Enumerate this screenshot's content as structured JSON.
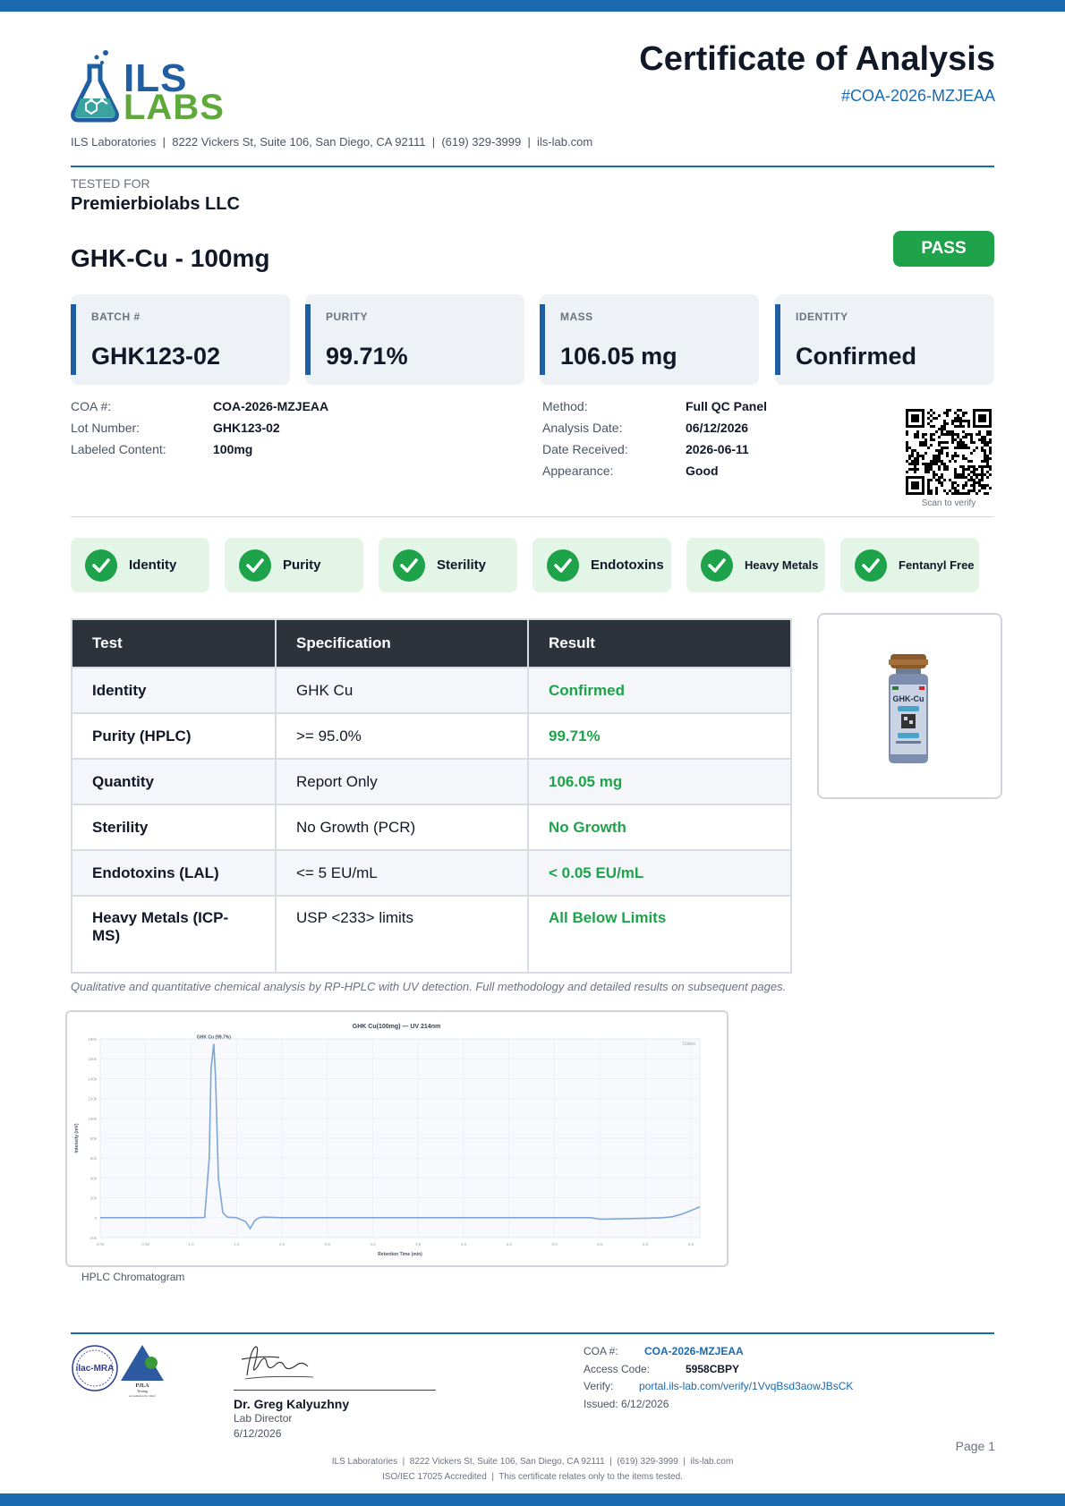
{
  "header": {
    "logo_text_top": "ILS",
    "logo_text_bottom": "LABS",
    "address_line": "ILS Laboratories  |  8222 Vickers St, Suite 106, San Diego, CA 92111  |  (619) 329-3999  |  ils-lab.com",
    "title": "Certificate of Analysis",
    "coa_ref": "#COA-2026-MZJEAA"
  },
  "client": {
    "label": "TESTED FOR",
    "name": "Premierbiolabs LLC"
  },
  "product": {
    "name": "GHK-Cu - 100mg",
    "status": "PASS"
  },
  "stats": [
    {
      "label": "BATCH #",
      "value": "GHK123-02"
    },
    {
      "label": "PURITY",
      "value": "99.71%"
    },
    {
      "label": "MASS",
      "value": "106.05 mg"
    },
    {
      "label": "IDENTITY",
      "value": "Confirmed"
    }
  ],
  "details_left": [
    {
      "key": "COA #:",
      "value": "COA-2026-MZJEAA"
    },
    {
      "key": "Lot Number:",
      "value": "GHK123-02"
    },
    {
      "key": "Labeled Content:",
      "value": "100mg"
    }
  ],
  "details_right": [
    {
      "key": "Method:",
      "value": "Full QC Panel"
    },
    {
      "key": "Analysis Date:",
      "value": "06/12/2026"
    },
    {
      "key": "Date Received:",
      "value": "2026-06-11"
    },
    {
      "key": "Appearance:",
      "value": "Good"
    }
  ],
  "qr": {
    "caption": "Scan to verify"
  },
  "checks": [
    "Identity",
    "Purity",
    "Sterility",
    "Endotoxins",
    "Heavy Metals",
    "Fentanyl Free"
  ],
  "colors": {
    "brand_blue": "#1a6aaf",
    "pass_green": "#1ea34a",
    "table_header": "#2d333b",
    "check_bg": "#e2f5e7"
  },
  "results_table": {
    "headers": [
      "Test",
      "Specification",
      "Result"
    ],
    "rows": [
      {
        "test": "Identity",
        "spec": "GHK Cu",
        "result": "Confirmed"
      },
      {
        "test": "Purity (HPLC)",
        "spec": ">= 95.0%",
        "result": "99.71%"
      },
      {
        "test": "Quantity",
        "spec": "Report Only",
        "result": "106.05 mg"
      },
      {
        "test": "Sterility",
        "spec": "No Growth (PCR)",
        "result": "No Growth"
      },
      {
        "test": "Endotoxins (LAL)",
        "spec": "<= 5 EU/mL",
        "result": "< 0.05 EU/mL"
      },
      {
        "test": "Heavy Metals (ICP-MS)",
        "spec": "USP <233> limits",
        "result": "All Below Limits"
      }
    ]
  },
  "vial": {
    "label": "GHK-Cu"
  },
  "method_note": "Qualitative and quantitative chemical analysis by RP-HPLC with UV detection. Full methodology and detailed results on subsequent pages.",
  "chromatogram": {
    "title": "GHK Cu(100mg) — UV 214nm",
    "peak_label": "GHK Cu (99.7%)",
    "legend": "Colors",
    "xlabel": "Retention Time (min)",
    "ylabel": "Intensity (mV)",
    "x_ticks": [
      "0.00",
      "0.50",
      "1.0",
      "1.5",
      "2.0",
      "2.5",
      "3.0",
      "3.5",
      "4.0",
      "4.5",
      "5.0",
      "5.5",
      "6.0",
      "6.5"
    ],
    "y_ticks": [
      "-20k",
      "0",
      "20k",
      "40k",
      "60k",
      "80k",
      "100k",
      "120k",
      "140k",
      "160k",
      "180k"
    ],
    "caption": "HPLC Chromatogram"
  },
  "chart_data": {
    "type": "line",
    "title": "GHK Cu(100mg) — UV 214nm",
    "xlabel": "Retention Time (min)",
    "ylabel": "Intensity (mV)",
    "xlim": [
      0,
      6.6
    ],
    "ylim": [
      -20000,
      180000
    ],
    "series": [
      {
        "name": "GHK Cu (99.7%)",
        "x": [
          0.0,
          0.5,
          1.0,
          1.15,
          1.2,
          1.22,
          1.25,
          1.27,
          1.3,
          1.35,
          1.4,
          1.5,
          1.6,
          1.65,
          1.7,
          1.75,
          1.8,
          2.0,
          3.0,
          4.0,
          5.0,
          5.4,
          5.5,
          5.8,
          6.0,
          6.2,
          6.3,
          6.4,
          6.5,
          6.6
        ],
        "y": [
          0,
          0,
          0,
          200,
          60000,
          150000,
          175000,
          140000,
          40000,
          5000,
          500,
          0,
          -4000,
          -11000,
          -3000,
          0,
          500,
          0,
          0,
          0,
          0,
          0,
          -1500,
          -1000,
          -500,
          0,
          1000,
          3500,
          7000,
          11000
        ]
      }
    ]
  },
  "signature": {
    "name": "Dr. Greg Kalyuzhny",
    "title": "Lab Director",
    "date": "6/12/2026"
  },
  "accreditation": {
    "seal1": "ilac-MRA",
    "seal2": "PJLA",
    "seal2_sub": "Testing",
    "seal2_num": "Accreditation No. 59412"
  },
  "footer_info": {
    "coa_key": "COA #:",
    "coa_value": "COA-2026-MZJEAA",
    "access_key": "Access Code:",
    "access_value": "5958CBPY",
    "verify_key": "Verify:",
    "verify_value": "portal.ils-lab.com/verify/1VvqBsd3aowJBsCK",
    "issued": "Issued: 6/12/2026"
  },
  "page_number": "Page 1",
  "footer": {
    "line1": "ILS Laboratories  |  8222 Vickers St, Suite 106, San Diego, CA 92111  |  (619) 329-3999  |  ils-lab.com",
    "line2": "ISO/IEC 17025 Accredited  |  This certificate relates only to the items tested."
  }
}
